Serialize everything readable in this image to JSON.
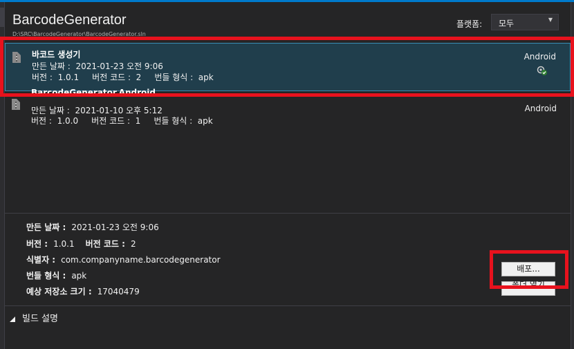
{
  "app": {
    "title": "BarcodeGenerator",
    "path": "D:\\SRC\\BarcodeGenerator\\BarcodeGenerator.sln"
  },
  "platform": {
    "label": "플랫폼:",
    "selected": "모두"
  },
  "archives": [
    {
      "name": "바코드 생성기",
      "created": "만든 날짜 :  2021-01-23 오전 9:06",
      "version_line": "버전 :  1.0.1     버전 코드 :  2     번들 형식 :  apk",
      "platform": "Android",
      "icon": "android-build-icon"
    },
    {
      "name": "BarcodeGenerator.Android",
      "created": "만든 날짜 :  2021-01-10 오후 5:12",
      "version_line": "버전 :  1.0.0     버전 코드 :  1     번들 형식 :  apk",
      "platform": "Android"
    }
  ],
  "details": {
    "created_label": "만든 날짜 :",
    "created_value": "2021-01-23 오전 9:06",
    "version_label": "버전 :",
    "version_value": "1.0.1",
    "version_code_label": "버전 코드 :",
    "version_code_value": "2",
    "identifier_label": "식별자 :",
    "identifier_value": "com.companyname.barcodegenerator",
    "bundle_label": "번들 형식 :",
    "bundle_value": "apk",
    "size_label": "예상 저장소 크기 :",
    "size_value": "17040479"
  },
  "buttons": {
    "deploy": "배포...",
    "open_folder": "폴더 열기"
  },
  "build_notes": {
    "label": "빌드 설명"
  },
  "colors": {
    "accent": "#007acc",
    "selection_bg": "#203e4c",
    "highlight": "#e8121d"
  }
}
